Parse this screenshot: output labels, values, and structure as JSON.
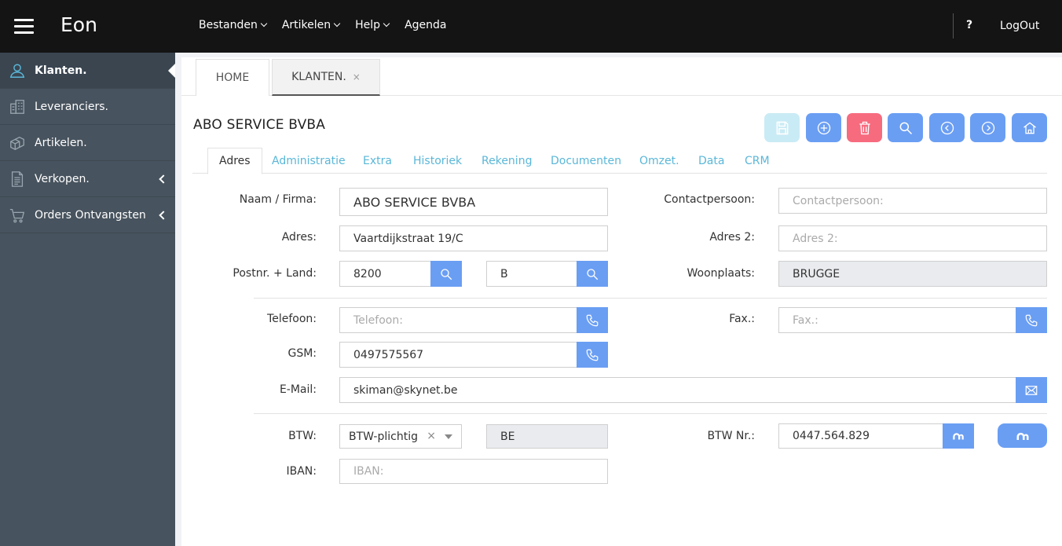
{
  "app": {
    "brand": "Eon"
  },
  "topmenu": {
    "items": [
      {
        "label": "Bestanden"
      },
      {
        "label": "Artikelen"
      },
      {
        "label": "Help"
      },
      {
        "label": "Agenda"
      }
    ],
    "help": "?",
    "logout": "LogOut"
  },
  "sidebar": {
    "items": [
      {
        "label": "Klanten.",
        "icon": "user-icon"
      },
      {
        "label": "Leveranciers.",
        "icon": "building-icon"
      },
      {
        "label": "Artikelen.",
        "icon": "boxes-icon"
      },
      {
        "label": "Verkopen.",
        "icon": "document-icon"
      },
      {
        "label": "Orders Ontvangsten",
        "icon": "cart-icon"
      }
    ]
  },
  "pagetabs": {
    "home": "HOME",
    "klanten": "KLANTEN.",
    "close": "×"
  },
  "record": {
    "title": "ABO SERVICE BVBA"
  },
  "formtabs": [
    "Adres",
    "Administratie",
    "Extra",
    "Historiek",
    "Rekening",
    "Documenten",
    "Omzet.",
    "Data",
    "CRM"
  ],
  "form": {
    "naam_label": "Naam / Firma:",
    "naam_value": "ABO SERVICE BVBA",
    "contact_label": "Contactpersoon:",
    "contact_placeholder": "Contactpersoon:",
    "adres_label": "Adres:",
    "adres_value": "Vaartdijkstraat 19/C",
    "adres2_label": "Adres 2:",
    "adres2_placeholder": "Adres 2:",
    "postnr_label": "Postnr. + Land:",
    "postnr_value": "8200",
    "land_value": "B",
    "woonplaats_label": "Woonplaats:",
    "woonplaats_value": "BRUGGE",
    "telefoon_label": "Telefoon:",
    "telefoon_placeholder": "Telefoon:",
    "fax_label": "Fax.:",
    "fax_placeholder": "Fax.:",
    "gsm_label": "GSM:",
    "gsm_value": "0497575567",
    "email_label": "E-Mail:",
    "email_value": "skiman@skynet.be",
    "btw_label": "BTW:",
    "btw_select": "BTW-plichtig",
    "btw_clear": "×",
    "btw_country": "BE",
    "btwnr_label": "BTW Nr.:",
    "btwnr_value": "0447.564.829",
    "iban_label": "IBAN:",
    "iban_placeholder": "IBAN:"
  },
  "colors": {
    "accent": "#6a9ef3",
    "delete": "#f76b7f",
    "save": "#c9ebf5",
    "tablink": "#5ab7d8",
    "sidebar": "#47535e",
    "topbar": "#141414"
  }
}
